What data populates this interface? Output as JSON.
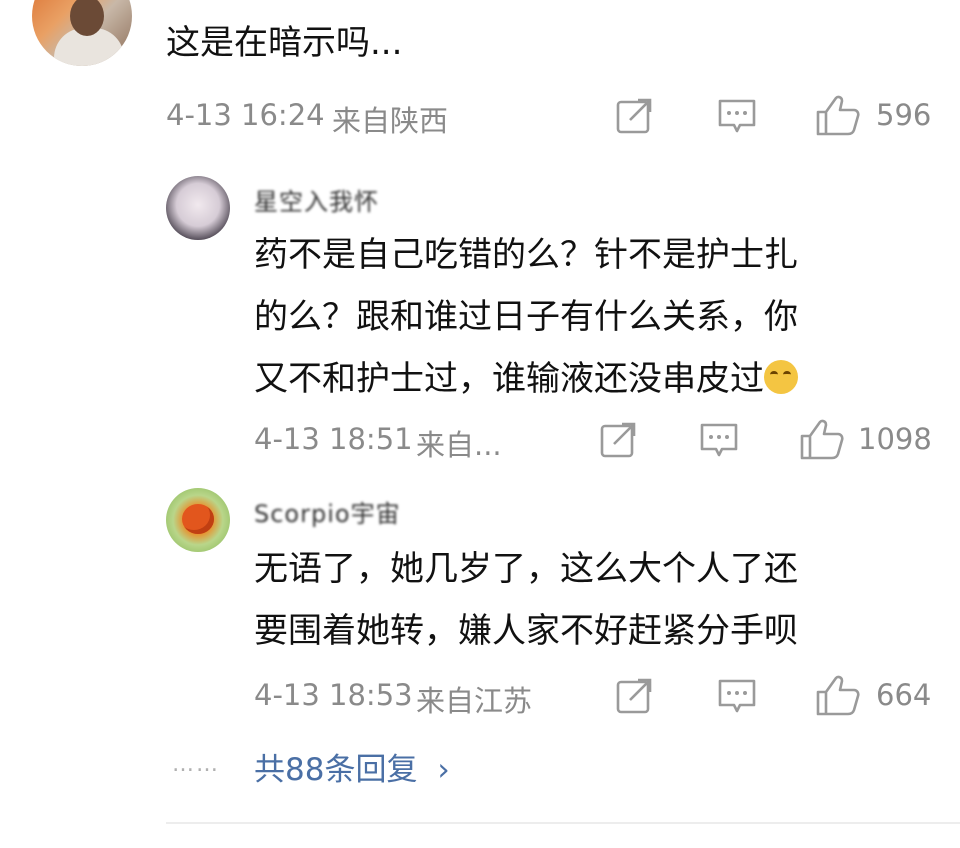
{
  "main_comment": {
    "text": "这是在暗示吗...",
    "time": "4-13 16:24",
    "location": "来自陕西",
    "likes": "596"
  },
  "replies": [
    {
      "username": "星空入我怀",
      "text_lines": [
        "药不是自己吃错的么？针不是护士扎",
        "的么？跟和谁过日子有什么关系，你",
        "又不和护士过，谁输液还没串皮过"
      ],
      "time": "4-13 18:51",
      "location": "来自...",
      "likes": "1098"
    },
    {
      "username": "Scorpio宇宙",
      "text_lines": [
        "无语了，她几岁了，这么大个人了还",
        "要围着她转，嫌人家不好赶紧分手呗"
      ],
      "time": "4-13 18:53",
      "location": "来自江苏",
      "likes": "664"
    }
  ],
  "more_replies": {
    "dots": "……",
    "label": "共88条回复",
    "arrow": "›"
  },
  "icons": {
    "repost": "repost-icon",
    "comment": "comment-icon",
    "like": "thumbs-up-icon",
    "emoji": "laugh-cry-emoji-icon"
  },
  "colors": {
    "meta_gray": "#8a8a8a",
    "link_blue": "#4a6fa5",
    "icon_gray": "#9a9a9a"
  }
}
